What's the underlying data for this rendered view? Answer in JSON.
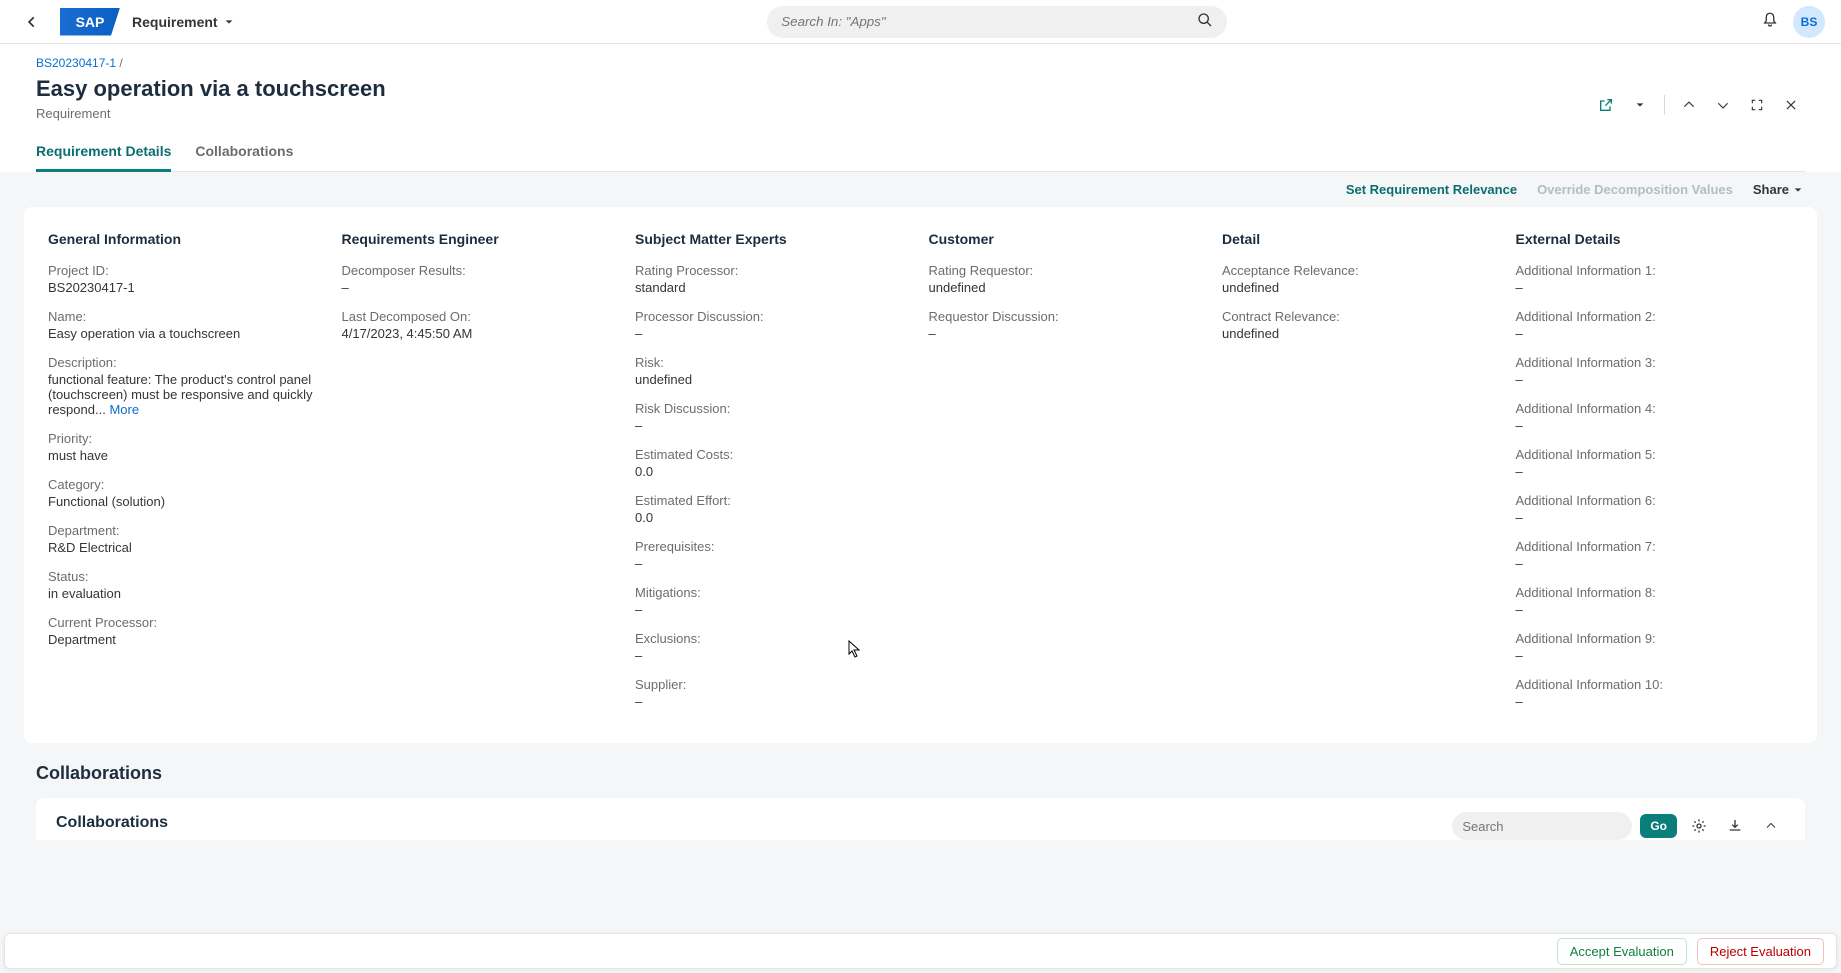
{
  "header": {
    "logo_text": "SAP",
    "app_title": "Requirement",
    "search_placeholder": "Search In: \"Apps\"",
    "avatar": "BS"
  },
  "page": {
    "breadcrumb_link": "BS20230417-1",
    "breadcrumb_sep": " /",
    "title": "Easy operation via a touchscreen",
    "subtitle": "Requirement"
  },
  "tabs": {
    "details": "Requirement Details",
    "collab": "Collaborations"
  },
  "actions": {
    "set_relevance": "Set Requirement Relevance",
    "override": "Override Decomposition Values",
    "share": "Share"
  },
  "general": {
    "heading": "General Information",
    "project_id_label": "Project ID:",
    "project_id": "BS20230417-1",
    "name_label": "Name:",
    "name": "Easy operation via a touchscreen",
    "desc_label": "Description:",
    "desc": "functional feature: The product's control panel (touchscreen) must be responsive and quickly respond... ",
    "more": "More",
    "priority_label": "Priority:",
    "priority": "must have",
    "category_label": "Category:",
    "category": "Functional (solution)",
    "department_label": "Department:",
    "department": "R&D Electrical",
    "status_label": "Status:",
    "status": "in evaluation",
    "current_processor_label": "Current Processor:",
    "current_processor": "Department"
  },
  "engineer": {
    "heading": "Requirements Engineer",
    "decomposer_label": "Decomposer Results:",
    "decomposer": "–",
    "last_decomposed_label": "Last Decomposed On:",
    "last_decomposed": "4/17/2023, 4:45:50 AM"
  },
  "sme": {
    "heading": "Subject Matter Experts",
    "rating_processor_label": "Rating Processor:",
    "rating_processor": "standard",
    "processor_discussion_label": "Processor Discussion:",
    "processor_discussion": "–",
    "risk_label": "Risk:",
    "risk": "undefined",
    "risk_discussion_label": "Risk Discussion:",
    "risk_discussion": "–",
    "est_costs_label": "Estimated Costs:",
    "est_costs": "0.0",
    "est_effort_label": "Estimated Effort:",
    "est_effort": "0.0",
    "prereq_label": "Prerequisites:",
    "prereq": "–",
    "mitigations_label": "Mitigations:",
    "mitigations": "–",
    "exclusions_label": "Exclusions:",
    "exclusions": "–",
    "supplier_label": "Supplier:",
    "supplier": "–"
  },
  "customer": {
    "heading": "Customer",
    "rating_requestor_label": "Rating Requestor:",
    "rating_requestor": "undefined",
    "requestor_discussion_label": "Requestor Discussion:",
    "requestor_discussion": "–"
  },
  "detail": {
    "heading": "Detail",
    "acceptance_label": "Acceptance Relevance:",
    "acceptance": "undefined",
    "contract_label": "Contract Relevance:",
    "contract": "undefined"
  },
  "external": {
    "heading": "External Details",
    "info1_label": "Additional Information 1:",
    "info1": "–",
    "info2_label": "Additional Information 2:",
    "info2": "–",
    "info3_label": "Additional Information 3:",
    "info3": "–",
    "info4_label": "Additional Information 4:",
    "info4": "–",
    "info5_label": "Additional Information 5:",
    "info5": "–",
    "info6_label": "Additional Information 6:",
    "info6": "–",
    "info7_label": "Additional Information 7:",
    "info7": "–",
    "info8_label": "Additional Information 8:",
    "info8": "–",
    "info9_label": "Additional Information 9:",
    "info9": "–",
    "info10_label": "Additional Information 10:",
    "info10": "–"
  },
  "collab": {
    "section_title": "Collaborations",
    "inner_title": "Collaborations",
    "search_placeholder": "Search",
    "go": "Go"
  },
  "footer": {
    "accept": "Accept Evaluation",
    "reject": "Reject Evaluation"
  }
}
